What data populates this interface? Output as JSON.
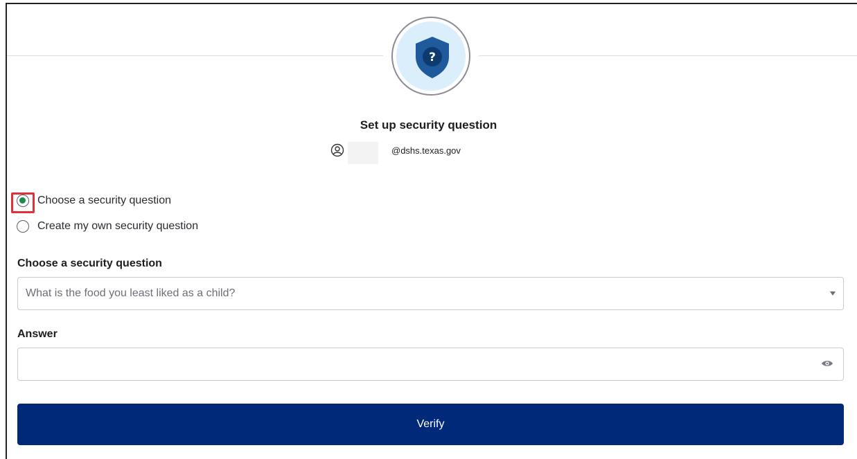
{
  "header": {
    "icon": "shield-question-icon",
    "title": "Set up security question"
  },
  "identifier": {
    "icon": "user-circle-icon",
    "email_suffix": "@dshs.texas.gov"
  },
  "options": {
    "choose_label": "Choose a security question",
    "create_label": "Create my own security question",
    "selected": "choose"
  },
  "question_field": {
    "label": "Choose a security question",
    "value": "What is the food you least liked as a child?"
  },
  "answer_field": {
    "label": "Answer",
    "value": "",
    "toggle_icon": "eye-icon"
  },
  "actions": {
    "verify_label": "Verify"
  },
  "colors": {
    "primary": "#00297a",
    "badge_bg": "#dbeefc",
    "shield": "#1e5a9c",
    "radio_checked": "#1d8a4c",
    "highlight": "#e0313b"
  }
}
